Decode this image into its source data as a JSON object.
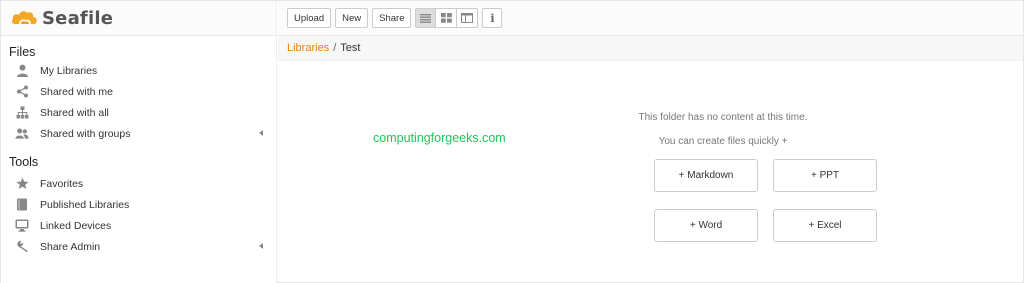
{
  "app": {
    "name": "Seafile"
  },
  "sidebar": {
    "files_title": "Files",
    "files_items": [
      {
        "label": "My Libraries",
        "icon": "user-icon"
      },
      {
        "label": "Shared with me",
        "icon": "share-icon"
      },
      {
        "label": "Shared with all",
        "icon": "sitemap-icon"
      },
      {
        "label": "Shared with groups",
        "icon": "group-icon",
        "expandable": true
      }
    ],
    "tools_title": "Tools",
    "tools_items": [
      {
        "label": "Favorites",
        "icon": "star-icon"
      },
      {
        "label": "Published Libraries",
        "icon": "book-icon"
      },
      {
        "label": "Linked Devices",
        "icon": "monitor-icon"
      },
      {
        "label": "Share Admin",
        "icon": "wrench-icon",
        "expandable": true
      }
    ]
  },
  "toolbar": {
    "upload_label": "Upload",
    "new_label": "New",
    "share_label": "Share",
    "views": [
      "list-view-icon",
      "grid-view-icon",
      "column-view-icon"
    ],
    "active_view": "list-view-icon",
    "info_label": "i"
  },
  "breadcrumb": {
    "root": "Libraries",
    "separator": "/",
    "current": "Test"
  },
  "watermark": "computingforgeeks.com",
  "empty_state": {
    "title": "This folder has no content at this time.",
    "subtitle": "You can create files quickly +",
    "buttons": [
      "+ Markdown",
      "+ PPT",
      "+ Word",
      "+ Excel"
    ]
  },
  "colors": {
    "accent": "#eb8205",
    "watermark": "#22c45a",
    "icon": "#888888"
  }
}
